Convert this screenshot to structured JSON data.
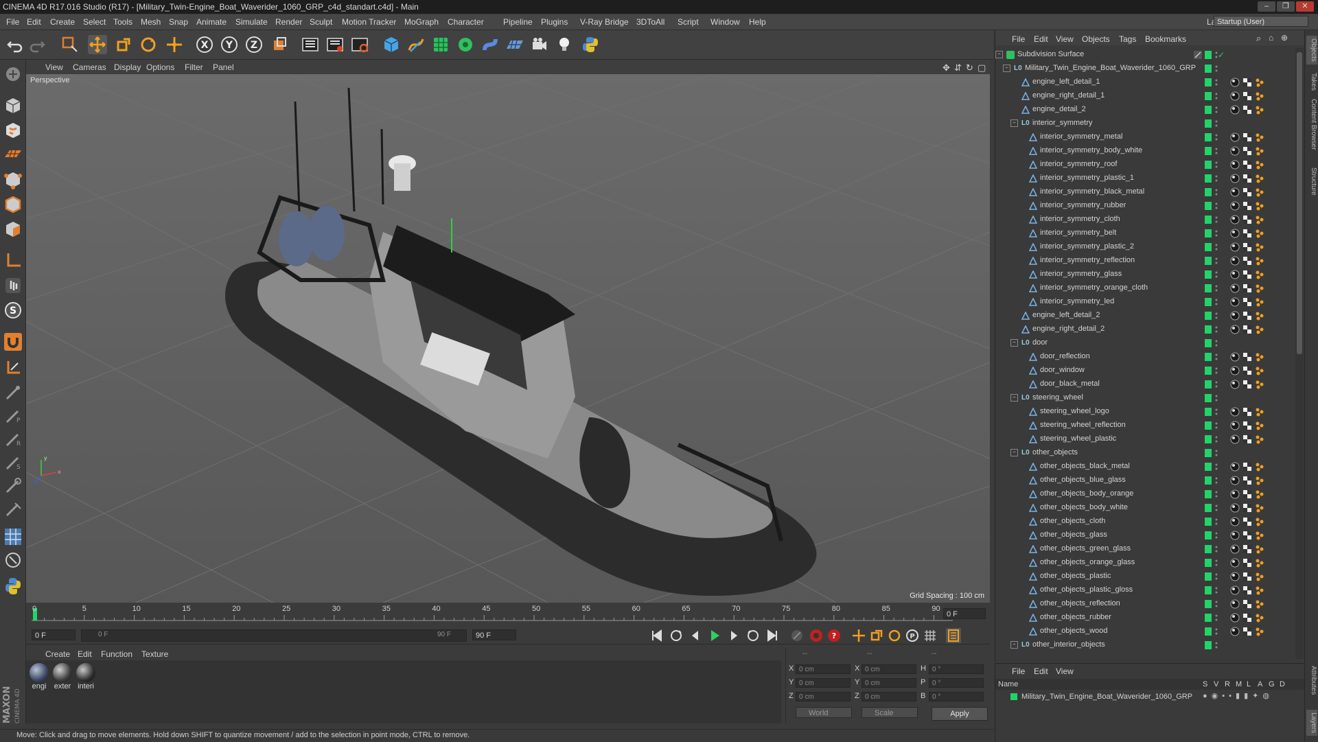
{
  "window": {
    "title": "CINEMA 4D R17.016 Studio (R17) - [Military_Twin-Engine_Boat_Waverider_1060_GRP_c4d_standart.c4d] - Main",
    "controls": [
      "–",
      "❐",
      "✕"
    ]
  },
  "menubar": {
    "items": [
      "File",
      "Edit",
      "Create",
      "Select",
      "Tools",
      "Mesh",
      "Snap",
      "Animate",
      "Simulate",
      "Render",
      "Sculpt",
      "Motion Tracker",
      "MoGraph",
      "Character",
      "Pipeline",
      "Plugins",
      "V-Ray Bridge",
      "3DToAll",
      "Script",
      "Window",
      "Help"
    ],
    "layout_label": "Layout:",
    "layout_value": "Startup (User)"
  },
  "toolbar": {
    "icons": [
      "undo-icon",
      "redo-icon",
      "live-selection-icon",
      "move-icon",
      "scale-icon",
      "rotate-icon",
      "transform-icon",
      "x-axis-icon",
      "y-axis-icon",
      "z-axis-icon",
      "coordinate-system-icon",
      "render-view-icon",
      "render-picture-viewer-icon",
      "render-settings-icon",
      "cube-icon",
      "pen-spline-icon",
      "subdivision-icon",
      "cloner-icon",
      "deformer-icon",
      "floor-icon",
      "camera-icon",
      "light-icon",
      "python-icon"
    ]
  },
  "left_palette": {
    "icons": [
      "make-editable-icon",
      "model-mode-icon",
      "texture-mode-icon",
      "workplane-icon",
      "points-mode-icon",
      "edges-mode-icon",
      "polygons-mode-icon",
      "axis-mode-icon",
      "tweak-icon",
      "soft-selection-icon",
      "magnet-icon",
      "snap-icon",
      "knife-icon",
      "brush-icon",
      "sculpt-smooth-icon",
      "sculpt-pull-icon",
      "sculpt-flatten-icon",
      "sculpt-inflate-icon",
      "grid-snap-icon",
      "solo-icon",
      "python-script-icon"
    ]
  },
  "viewport": {
    "menu": [
      "View",
      "Cameras",
      "Display",
      "Options",
      "Filter",
      "Panel"
    ],
    "label": "Perspective",
    "grid_spacing": "Grid Spacing : 100 cm"
  },
  "timeline": {
    "ticks": [
      "0",
      "5",
      "10",
      "15",
      "20",
      "25",
      "30",
      "35",
      "40",
      "45",
      "50",
      "55",
      "60",
      "65",
      "70",
      "75",
      "80",
      "85",
      "90"
    ],
    "current_frame": "0 F",
    "start_field": "0 F",
    "range_start": "0 F",
    "range_end": "90 F",
    "end_field": "90 F",
    "transport_icons": [
      "go-start-icon",
      "prev-key-icon",
      "prev-frame-icon",
      "play-icon",
      "next-frame-icon",
      "next-key-icon",
      "go-end-icon",
      "motion-record-icon",
      "record-icon",
      "autokey-icon",
      "keyframe-move-icon",
      "keyframe-scale-icon",
      "keyframe-rotate-icon",
      "keyframe-param-icon",
      "keyframe-pla-icon",
      "timeline-icon"
    ]
  },
  "material_manager": {
    "menu": [
      "Create",
      "Edit",
      "Function",
      "Texture"
    ],
    "materials": [
      {
        "label": "engi"
      },
      {
        "label": "exter"
      },
      {
        "label": "interi"
      }
    ]
  },
  "coordinates": {
    "header": [
      "--",
      "--",
      "--"
    ],
    "rows": [
      {
        "a": "X",
        "av": "0 cm",
        "b": "X",
        "bv": "0 cm",
        "c": "H",
        "cv": "0 °"
      },
      {
        "a": "Y",
        "av": "0 cm",
        "b": "Y",
        "bv": "0 cm",
        "c": "P",
        "cv": "0 °"
      },
      {
        "a": "Z",
        "av": "0 cm",
        "b": "Z",
        "bv": "0 cm",
        "c": "B",
        "cv": "0 °"
      }
    ],
    "mode": "World",
    "scale": "Scale",
    "apply": "Apply"
  },
  "status": {
    "text": "Move: Click and drag to move elements. Hold down SHIFT to quantize movement / add to the selection in point mode, CTRL to remove."
  },
  "object_manager": {
    "menu": [
      "File",
      "Edit",
      "View",
      "Objects",
      "Tags",
      "Bookmarks"
    ],
    "rows": [
      {
        "name": "Subdivision Surface",
        "level": 0,
        "kind": "subd",
        "fold": "-",
        "tags": ""
      },
      {
        "name": "Military_Twin_Engine_Boat_Waverider_1060_GRP",
        "level": 1,
        "kind": "null",
        "fold": "-",
        "tags": ""
      },
      {
        "name": "engine_left_detail_1",
        "level": 2,
        "kind": "poly",
        "fold": "",
        "tags": "m"
      },
      {
        "name": "engine_right_detail_1",
        "level": 2,
        "kind": "poly",
        "fold": "",
        "tags": "m"
      },
      {
        "name": "engine_detail_2",
        "level": 2,
        "kind": "poly",
        "fold": "",
        "tags": "m"
      },
      {
        "name": "interior_symmetry",
        "level": 2,
        "kind": "null",
        "fold": "-",
        "tags": ""
      },
      {
        "name": "interior_symmetry_metal",
        "level": 3,
        "kind": "poly",
        "fold": "",
        "tags": "m"
      },
      {
        "name": "interior_symmetry_body_white",
        "level": 3,
        "kind": "poly",
        "fold": "",
        "tags": "m"
      },
      {
        "name": "interior_symmetry_roof",
        "level": 3,
        "kind": "poly",
        "fold": "",
        "tags": "m"
      },
      {
        "name": "interior_symmetry_plastic_1",
        "level": 3,
        "kind": "poly",
        "fold": "",
        "tags": "m"
      },
      {
        "name": "interior_symmetry_black_metal",
        "level": 3,
        "kind": "poly",
        "fold": "",
        "tags": "m"
      },
      {
        "name": "interior_symmetry_rubber",
        "level": 3,
        "kind": "poly",
        "fold": "",
        "tags": "m"
      },
      {
        "name": "interior_symmetry_cloth",
        "level": 3,
        "kind": "poly",
        "fold": "",
        "tags": "m"
      },
      {
        "name": "interior_symmetry_belt",
        "level": 3,
        "kind": "poly",
        "fold": "",
        "tags": "m"
      },
      {
        "name": "interior_symmetry_plastic_2",
        "level": 3,
        "kind": "poly",
        "fold": "",
        "tags": "m"
      },
      {
        "name": "interior_symmetry_reflection",
        "level": 3,
        "kind": "poly",
        "fold": "",
        "tags": "m"
      },
      {
        "name": "interior_symmetry_glass",
        "level": 3,
        "kind": "poly",
        "fold": "",
        "tags": "m"
      },
      {
        "name": "interior_symmetry_orange_cloth",
        "level": 3,
        "kind": "poly",
        "fold": "",
        "tags": "m"
      },
      {
        "name": "interior_symmetry_led",
        "level": 3,
        "kind": "poly",
        "fold": "",
        "tags": "m"
      },
      {
        "name": "engine_left_detail_2",
        "level": 2,
        "kind": "poly",
        "fold": "",
        "tags": "m"
      },
      {
        "name": "engine_right_detail_2",
        "level": 2,
        "kind": "poly",
        "fold": "",
        "tags": "m"
      },
      {
        "name": "door",
        "level": 2,
        "kind": "null",
        "fold": "-",
        "tags": ""
      },
      {
        "name": "door_reflection",
        "level": 3,
        "kind": "poly",
        "fold": "",
        "tags": "m"
      },
      {
        "name": "door_window",
        "level": 3,
        "kind": "poly",
        "fold": "",
        "tags": "m"
      },
      {
        "name": "door_black_metal",
        "level": 3,
        "kind": "poly",
        "fold": "",
        "tags": "m"
      },
      {
        "name": "steering_wheel",
        "level": 2,
        "kind": "null",
        "fold": "-",
        "tags": ""
      },
      {
        "name": "steering_wheel_logo",
        "level": 3,
        "kind": "poly",
        "fold": "",
        "tags": "m"
      },
      {
        "name": "steering_wheel_reflection",
        "level": 3,
        "kind": "poly",
        "fold": "",
        "tags": "m"
      },
      {
        "name": "steering_wheel_plastic",
        "level": 3,
        "kind": "poly",
        "fold": "",
        "tags": "m"
      },
      {
        "name": "other_objects",
        "level": 2,
        "kind": "null",
        "fold": "-",
        "tags": ""
      },
      {
        "name": "other_objects_black_metal",
        "level": 3,
        "kind": "poly",
        "fold": "",
        "tags": "m"
      },
      {
        "name": "other_objects_blue_glass",
        "level": 3,
        "kind": "poly",
        "fold": "",
        "tags": "m"
      },
      {
        "name": "other_objects_body_orange",
        "level": 3,
        "kind": "poly",
        "fold": "",
        "tags": "m"
      },
      {
        "name": "other_objects_body_white",
        "level": 3,
        "kind": "poly",
        "fold": "",
        "tags": "m"
      },
      {
        "name": "other_objects_cloth",
        "level": 3,
        "kind": "poly",
        "fold": "",
        "tags": "m"
      },
      {
        "name": "other_objects_glass",
        "level": 3,
        "kind": "poly",
        "fold": "",
        "tags": "m"
      },
      {
        "name": "other_objects_green_glass",
        "level": 3,
        "kind": "poly",
        "fold": "",
        "tags": "m"
      },
      {
        "name": "other_objects_orange_glass",
        "level": 3,
        "kind": "poly",
        "fold": "",
        "tags": "m"
      },
      {
        "name": "other_objects_plastic",
        "level": 3,
        "kind": "poly",
        "fold": "",
        "tags": "m"
      },
      {
        "name": "other_objects_plastic_gloss",
        "level": 3,
        "kind": "poly",
        "fold": "",
        "tags": "m"
      },
      {
        "name": "other_objects_reflection",
        "level": 3,
        "kind": "poly",
        "fold": "",
        "tags": "m"
      },
      {
        "name": "other_objects_rubber",
        "level": 3,
        "kind": "poly",
        "fold": "",
        "tags": "m"
      },
      {
        "name": "other_objects_wood",
        "level": 3,
        "kind": "poly",
        "fold": "",
        "tags": "m"
      },
      {
        "name": "other_interior_objects",
        "level": 2,
        "kind": "null",
        "fold": "-",
        "tags": ""
      }
    ]
  },
  "right_tabs": [
    "Objects",
    "Takes",
    "Content Browser",
    "Structure",
    "Attributes",
    "Layers"
  ],
  "layer_manager": {
    "menu": [
      "File",
      "Edit",
      "View"
    ],
    "columns": [
      "Name",
      "S",
      "V",
      "R",
      "M",
      "L",
      "A",
      "G",
      "D"
    ],
    "row": "Military_Twin_Engine_Boat_Waverider_1060_GRP"
  },
  "colors": {
    "accent_green": "#22d36a",
    "viewport_bg": "#5e5e5e",
    "ui_bg": "#3b3b3b",
    "axis_x": "#e04040",
    "axis_y": "#40d040"
  },
  "logo": {
    "text": "MAXON CINEMA 4D"
  }
}
